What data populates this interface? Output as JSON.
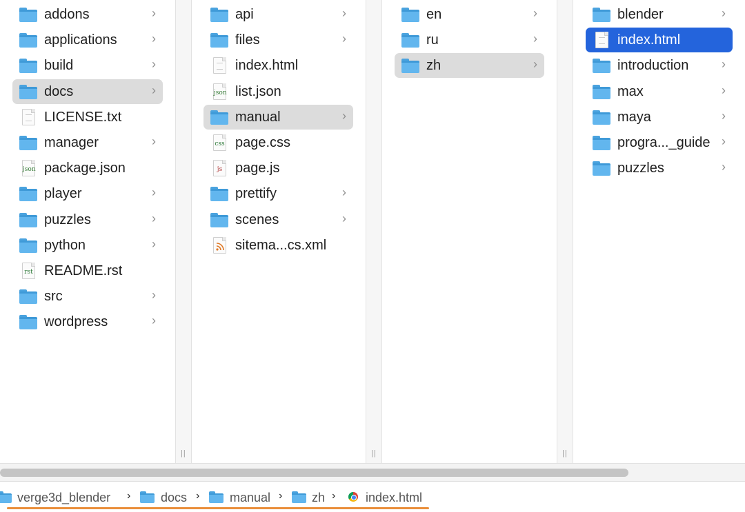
{
  "columns": [
    {
      "items": [
        {
          "label": "addons",
          "kind": "folder",
          "icon": "folder-icon",
          "chevron": true,
          "selected": ""
        },
        {
          "label": "applications",
          "kind": "folder",
          "icon": "folder-icon",
          "chevron": true,
          "selected": ""
        },
        {
          "label": "build",
          "kind": "folder",
          "icon": "folder-icon",
          "chevron": true,
          "selected": ""
        },
        {
          "label": "docs",
          "kind": "folder",
          "icon": "folder-icon",
          "chevron": true,
          "selected": "gray"
        },
        {
          "label": "LICENSE.txt",
          "kind": "file",
          "icon": "text-file-icon",
          "tag": "",
          "tag_color": "#888888",
          "chevron": false,
          "selected": ""
        },
        {
          "label": "manager",
          "kind": "folder",
          "icon": "folder-icon",
          "chevron": true,
          "selected": ""
        },
        {
          "label": "package.json",
          "kind": "file",
          "icon": "json-file-icon",
          "tag": "json",
          "tag_color": "#3b7f3b",
          "chevron": false,
          "selected": ""
        },
        {
          "label": "player",
          "kind": "folder",
          "icon": "folder-icon",
          "chevron": true,
          "selected": ""
        },
        {
          "label": "puzzles",
          "kind": "folder",
          "icon": "folder-icon",
          "chevron": true,
          "selected": ""
        },
        {
          "label": "python",
          "kind": "folder",
          "icon": "folder-icon",
          "chevron": true,
          "selected": ""
        },
        {
          "label": "README.rst",
          "kind": "file",
          "icon": "rst-file-icon",
          "tag": "rst",
          "tag_color": "#2f7a3a",
          "chevron": false,
          "selected": ""
        },
        {
          "label": "src",
          "kind": "folder",
          "icon": "folder-icon",
          "chevron": true,
          "selected": ""
        },
        {
          "label": "wordpress",
          "kind": "folder",
          "icon": "folder-icon",
          "chevron": true,
          "selected": ""
        }
      ]
    },
    {
      "items": [
        {
          "label": "api",
          "kind": "folder",
          "icon": "folder-icon",
          "chevron": true,
          "selected": ""
        },
        {
          "label": "files",
          "kind": "folder",
          "icon": "folder-icon",
          "chevron": true,
          "selected": ""
        },
        {
          "label": "index.html",
          "kind": "file",
          "icon": "html-file-icon",
          "tag": "",
          "tag_color": "#666666",
          "chevron": false,
          "selected": ""
        },
        {
          "label": "list.json",
          "kind": "file",
          "icon": "json-file-icon",
          "tag": "json",
          "tag_color": "#3b7f3b",
          "chevron": false,
          "selected": ""
        },
        {
          "label": "manual",
          "kind": "folder",
          "icon": "folder-icon",
          "chevron": true,
          "selected": "gray"
        },
        {
          "label": "page.css",
          "kind": "file",
          "icon": "css-file-icon",
          "tag": "css",
          "tag_color": "#2f7a3a",
          "chevron": false,
          "selected": ""
        },
        {
          "label": "page.js",
          "kind": "file",
          "icon": "js-file-icon",
          "tag": "js",
          "tag_color": "#b23a3a",
          "chevron": false,
          "selected": ""
        },
        {
          "label": "prettify",
          "kind": "folder",
          "icon": "folder-icon",
          "chevron": true,
          "selected": ""
        },
        {
          "label": "scenes",
          "kind": "folder",
          "icon": "folder-icon",
          "chevron": true,
          "selected": ""
        },
        {
          "label": "sitema...cs.xml",
          "kind": "file",
          "icon": "rss-file-icon",
          "tag": "",
          "tag_color": "#e07a28",
          "chevron": false,
          "selected": ""
        }
      ]
    },
    {
      "items": [
        {
          "label": "en",
          "kind": "folder",
          "icon": "folder-icon",
          "chevron": true,
          "selected": ""
        },
        {
          "label": "ru",
          "kind": "folder",
          "icon": "folder-icon",
          "chevron": true,
          "selected": ""
        },
        {
          "label": "zh",
          "kind": "folder",
          "icon": "folder-icon",
          "chevron": true,
          "selected": "gray"
        }
      ]
    },
    {
      "items": [
        {
          "label": "blender",
          "kind": "folder",
          "icon": "folder-icon",
          "chevron": true,
          "selected": ""
        },
        {
          "label": "index.html",
          "kind": "file",
          "icon": "html-file-icon",
          "tag": "",
          "tag_color": "#666666",
          "chevron": false,
          "selected": "blue"
        },
        {
          "label": "introduction",
          "kind": "folder",
          "icon": "folder-icon",
          "chevron": true,
          "selected": ""
        },
        {
          "label": "max",
          "kind": "folder",
          "icon": "folder-icon",
          "chevron": true,
          "selected": ""
        },
        {
          "label": "maya",
          "kind": "folder",
          "icon": "folder-icon",
          "chevron": true,
          "selected": ""
        },
        {
          "label": "progra..._guide",
          "kind": "folder",
          "icon": "folder-icon",
          "chevron": true,
          "selected": ""
        },
        {
          "label": "puzzles",
          "kind": "folder",
          "icon": "folder-icon",
          "chevron": true,
          "selected": ""
        }
      ]
    }
  ],
  "path_bar": {
    "crumbs": [
      {
        "label": "verge3d_blender",
        "icon": "folder-icon"
      },
      {
        "label": "docs",
        "icon": "folder-icon"
      },
      {
        "label": "manual",
        "icon": "folder-icon"
      },
      {
        "label": "zh",
        "icon": "folder-icon"
      },
      {
        "label": "index.html",
        "icon": "chrome-icon"
      }
    ],
    "highlight_color": "#ea8e3a"
  },
  "colors": {
    "selection_blue": "#2464dc",
    "selection_gray": "#dcdcdc",
    "folder_blue": "#62b6ee"
  },
  "glyphs": {
    "chevron": "›",
    "path_separator": "›",
    "grip": "||"
  }
}
